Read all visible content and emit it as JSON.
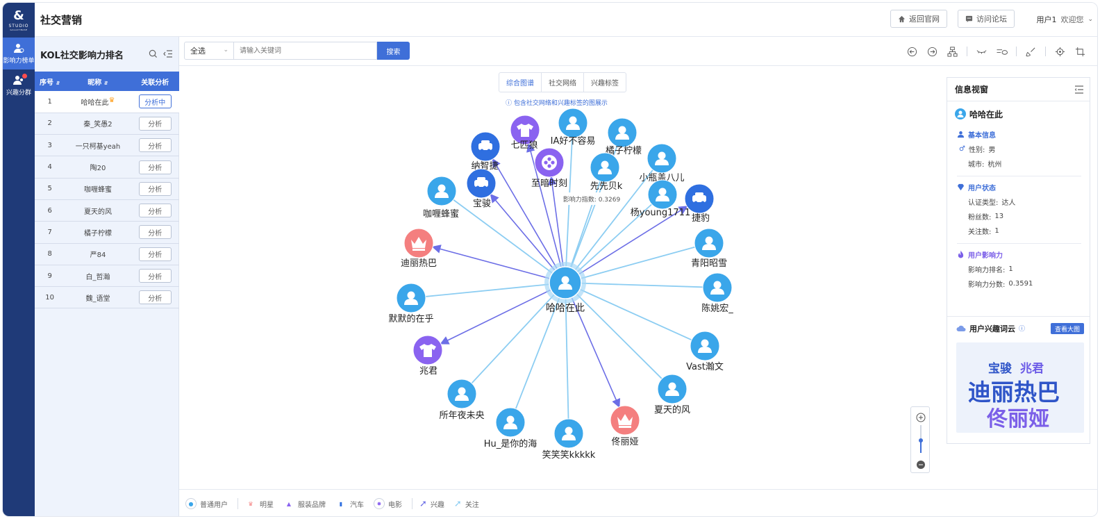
{
  "app": {
    "title": "社交营销",
    "logo_text": "STUDIO",
    "logo_sub": "GALAXYBASE"
  },
  "rail": [
    {
      "label": "影响力榜单",
      "active": true
    },
    {
      "label": "兴趣分群",
      "active": false
    }
  ],
  "header": {
    "home_btn": "返回官网",
    "forum_btn": "访问论坛",
    "user": "用户1",
    "welcome": "欢迎您"
  },
  "list_panel": {
    "title": "KOL社交影响力排名",
    "columns": [
      "序号",
      "昵称",
      "关联分析"
    ],
    "rows": [
      {
        "rank": "1",
        "name": "哈哈在此",
        "action": "分析中",
        "active": true
      },
      {
        "rank": "2",
        "name": "秦_笑愚2",
        "action": "分析",
        "active": false
      },
      {
        "rank": "3",
        "name": "一只柯基yeah",
        "action": "分析",
        "active": false
      },
      {
        "rank": "4",
        "name": "陶20",
        "action": "分析",
        "active": false
      },
      {
        "rank": "5",
        "name": "咖喱蜂蜜",
        "action": "分析",
        "active": false
      },
      {
        "rank": "6",
        "name": "夏天的风",
        "action": "分析",
        "active": false
      },
      {
        "rank": "7",
        "name": "橘子柠檬",
        "action": "分析",
        "active": false
      },
      {
        "rank": "8",
        "name": "严84",
        "action": "分析",
        "active": false
      },
      {
        "rank": "9",
        "name": "白_哲瀚",
        "action": "分析",
        "active": false
      },
      {
        "rank": "10",
        "name": "魏_语堂",
        "action": "分析",
        "active": false
      }
    ]
  },
  "search": {
    "select_value": "全选",
    "placeholder": "请输入关键词",
    "button": "搜索"
  },
  "graph": {
    "tabs": [
      "综合图谱",
      "社交网络",
      "兴趣标签"
    ],
    "active_tab": "综合图谱",
    "hint": "包含社交网络和兴趣标签的图展示",
    "tooltip": "影响力指数: 0.3269",
    "center": {
      "label": "哈哈在此"
    },
    "nodes": [
      {
        "label": "纳智捷",
        "kind": "car"
      },
      {
        "label": "七匹狼",
        "kind": "brand"
      },
      {
        "label": "IA好不容易",
        "kind": "user"
      },
      {
        "label": "橘子柠檬",
        "kind": "user"
      },
      {
        "label": "至暗时刻",
        "kind": "movie"
      },
      {
        "label": "先先贝k",
        "kind": "user"
      },
      {
        "label": "小瓶盖八儿",
        "kind": "user"
      },
      {
        "label": "咖喱蜂蜜",
        "kind": "user"
      },
      {
        "label": "宝骏",
        "kind": "car"
      },
      {
        "label": "杨young1711",
        "kind": "user"
      },
      {
        "label": "捷豹",
        "kind": "car"
      },
      {
        "label": "迪丽热巴",
        "kind": "star"
      },
      {
        "label": "青阳昭雪",
        "kind": "user"
      },
      {
        "label": "陈姚宏_",
        "kind": "user"
      },
      {
        "label": "默默的在乎",
        "kind": "user"
      },
      {
        "label": "兆君",
        "kind": "brand"
      },
      {
        "label": "Vast瀚文",
        "kind": "user"
      },
      {
        "label": "夏天的风",
        "kind": "user"
      },
      {
        "label": "所年夜未央",
        "kind": "user"
      },
      {
        "label": "Hu_是你的海",
        "kind": "user"
      },
      {
        "label": "笑笑笑kkkkk",
        "kind": "user"
      },
      {
        "label": "佟丽娅",
        "kind": "star"
      }
    ]
  },
  "info": {
    "title": "信息视窗",
    "name": "哈哈在此",
    "basic_title": "基本信息",
    "gender_label": "性别:",
    "gender": "男",
    "city_label": "城市:",
    "city": "杭州",
    "status_title": "用户状态",
    "cert_label": "认证类型:",
    "cert": "达人",
    "fans_label": "粉丝数:",
    "fans": "13",
    "follow_label": "关注数:",
    "follow": "1",
    "influence_title": "用户影响力",
    "rank_label": "影响力排名:",
    "rank": "1",
    "score_label": "影响力分数:",
    "score": "0.3591",
    "cloud_title": "用户兴趣词云",
    "cloud_btn": "查看大图",
    "cloud_words": [
      "宝骏",
      "兆君",
      "迪丽热巴",
      "佟丽娅"
    ]
  },
  "legend": [
    "普通用户",
    "明星",
    "服装品牌",
    "汽车",
    "电影",
    "兴趣",
    "关注"
  ],
  "colors": {
    "primary": "#3f6fd8",
    "rail": "#1f3a78",
    "user_node": "#3aa6ea",
    "car_node": "#2f6fe0",
    "brand_node": "#8a63f0",
    "star_node": "#f47f7f",
    "edge_follow": "#8ccdf2",
    "edge_interest": "#6c6ee6"
  }
}
